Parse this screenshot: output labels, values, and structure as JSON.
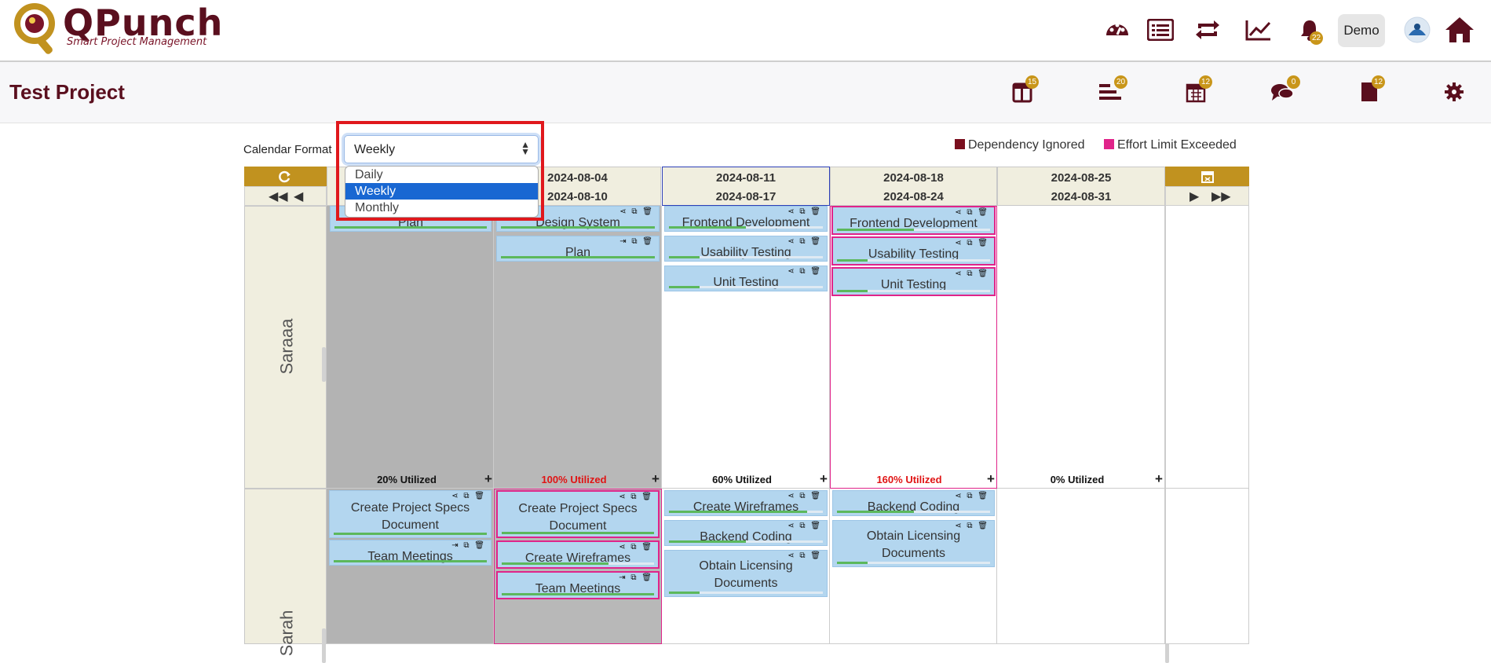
{
  "app": {
    "logo_text": "QPunch",
    "logo_tagline": "Smart Project Management"
  },
  "header": {
    "notification_count": "22",
    "user_button": "Demo",
    "icons": [
      "dashboard-icon",
      "list-icon",
      "repeat-icon",
      "chart-line-icon",
      "bell-icon",
      "avatar",
      "home-icon"
    ]
  },
  "project": {
    "title": "Test Project",
    "toolbar_badges": {
      "tasks": "15",
      "gantt": "20",
      "calendar": "12",
      "chat": "0",
      "docs": "12"
    }
  },
  "calendar": {
    "format_label": "Calendar Format",
    "format_value": "Weekly",
    "format_options": [
      "Daily",
      "Weekly",
      "Monthly"
    ],
    "legend": [
      {
        "label": "Dependency Ignored",
        "color": "#7a0f1e"
      },
      {
        "label": "Effort Limit Exceeded",
        "color": "#e0248a"
      }
    ],
    "weeks": [
      {
        "start": "2024-08-04",
        "end": "2024-08-10"
      },
      {
        "start": "2024-08-11",
        "end": "2024-08-17"
      },
      {
        "start": "2024-08-18",
        "end": "2024-08-24"
      },
      {
        "start": "2024-08-25",
        "end": "2024-08-31"
      }
    ],
    "rows": [
      {
        "name": "Saraaa",
        "weeks": [
          {
            "tasks": [
              "Plan"
            ],
            "utilization": "20% Utilized"
          },
          {
            "tasks": [
              "Design System",
              "Plan"
            ],
            "utilization": "100% Utilized"
          },
          {
            "tasks": [
              "Frontend Development",
              "Usability Testing",
              "Unit Testing"
            ],
            "utilization": "60% Utilized"
          },
          {
            "tasks": [
              "Frontend Development",
              "Usability Testing",
              "Unit Testing"
            ],
            "utilization": "160% Utilized"
          },
          {
            "tasks": [],
            "utilization": "0% Utilized"
          }
        ]
      },
      {
        "name": "Sarah",
        "weeks": [
          {
            "tasks": [
              "Create Project Specs Document",
              "Team Meetings"
            ]
          },
          {
            "tasks": [
              "Create Project Specs Document",
              "Create Wireframes",
              "Team Meetings"
            ]
          },
          {
            "tasks": [
              "Create Wireframes",
              "Backend Coding",
              "Obtain Licensing Documents"
            ]
          },
          {
            "tasks": [
              "Backend Coding",
              "Obtain Licensing Documents"
            ]
          },
          {
            "tasks": []
          }
        ]
      }
    ],
    "colors": {
      "gold": "#c1921f",
      "maroon": "#5a0f1e",
      "task_bg": "#b3d6ef",
      "over_limit": "#e0248a",
      "selected_option": "#1967d2"
    }
  }
}
